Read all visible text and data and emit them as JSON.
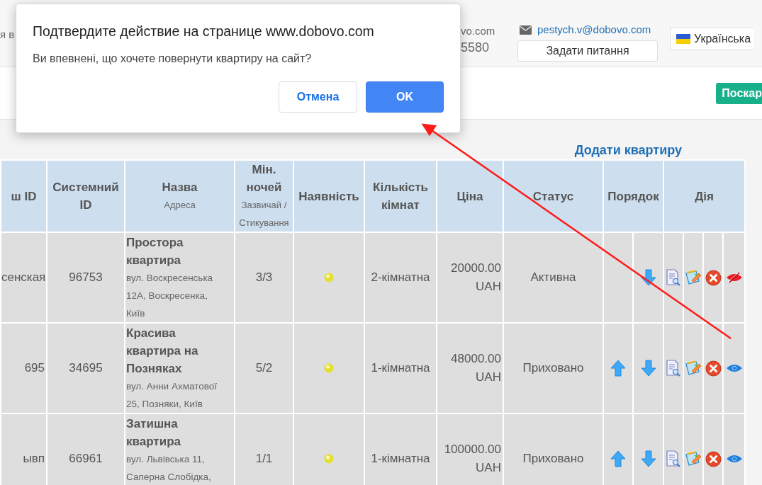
{
  "header": {
    "cut_left_text": "я в",
    "contact_site": "vo.com",
    "contact_phone": "5580",
    "email": "pestych.v@dobovo.com",
    "ask_button": "Задати питання",
    "language": "Українська"
  },
  "toolbar": {
    "green_button": "Поскар"
  },
  "add_link": "Додати квартиру",
  "table": {
    "columns": [
      {
        "title": "ш ID",
        "kind": "plain"
      },
      {
        "title": "Системний ID",
        "kind": "plain"
      },
      {
        "title": "Назва",
        "subtitle": "Адреса",
        "kind": "plain"
      },
      {
        "title": "Мін. ночей",
        "subtitle": "Зазвичай / Стикування",
        "kind": "plain"
      },
      {
        "title": "Наявність",
        "kind": "plain"
      },
      {
        "title": "Кількість кімнат",
        "kind": "plain"
      },
      {
        "title": "Ціна",
        "kind": "plain"
      },
      {
        "title": "Статус",
        "kind": "plain"
      },
      {
        "title": "Порядок",
        "kind": "order"
      },
      {
        "title": "Дія",
        "kind": "actions"
      }
    ],
    "rows": [
      {
        "my_id": "сенская",
        "system_id": "96753",
        "name": "Простора квартира",
        "address": "вул. Воскресенська 12А, Воскресенка, Київ",
        "nights": "3/3",
        "available": true,
        "rooms": "2-кімнатна",
        "price": "20000.00 UAH",
        "status": "Активна",
        "can_move_up": false,
        "visible": true
      },
      {
        "my_id": "695",
        "system_id": "34695",
        "name": "Красива квартира на Позняках",
        "address": "вул. Анни Ахматової 25, Позняки, Київ",
        "nights": "5/2",
        "available": true,
        "rooms": "1-кімнатна",
        "price": "48000.00 UAH",
        "status": "Приховано",
        "can_move_up": true,
        "visible": false
      },
      {
        "my_id": "ывп",
        "system_id": "66961",
        "name": "Затишна квартира",
        "address": "вул. Львівська 11, Саперна Слобідка,",
        "nights": "1/1",
        "available": true,
        "rooms": "1-кімнатна",
        "price": "100000.00 UAH",
        "status": "Приховано",
        "can_move_up": true,
        "visible": false
      }
    ]
  },
  "dialog": {
    "title": "Подтвердите действие на странице www.dobovo.com",
    "message": "Ви впевнені, що хочете повернути квартиру на сайт?",
    "buttons": [
      {
        "label": "Отмена",
        "kind": "secondary"
      },
      {
        "label": "OK",
        "kind": "primary"
      }
    ]
  }
}
